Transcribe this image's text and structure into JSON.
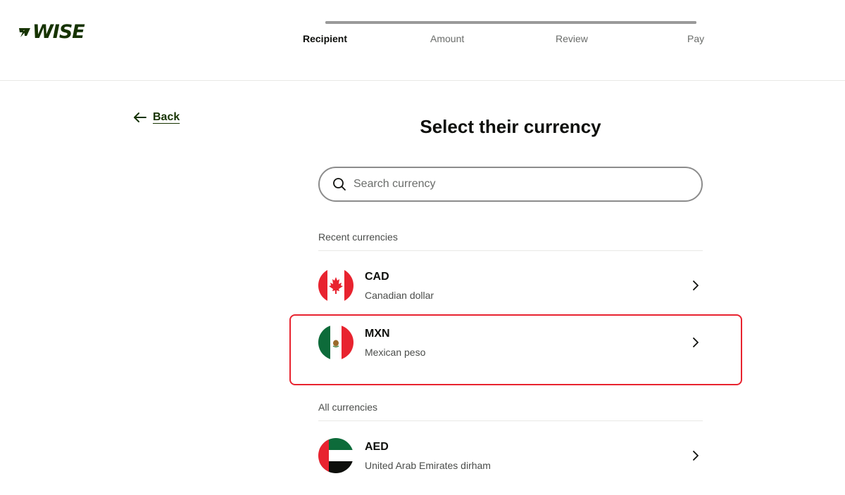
{
  "brand": {
    "name": "WISE",
    "color": "#163300",
    "logo_icon": "wise-flag-icon"
  },
  "steps": [
    {
      "label": "Recipient",
      "active": true
    },
    {
      "label": "Amount",
      "active": false
    },
    {
      "label": "Review",
      "active": false
    },
    {
      "label": "Pay",
      "active": false
    }
  ],
  "back": {
    "label": "Back",
    "icon": "arrow-left-icon"
  },
  "page": {
    "title": "Select their currency"
  },
  "search": {
    "placeholder": "Search currency",
    "value": "",
    "icon": "search-icon"
  },
  "sections": {
    "recent": {
      "label": "Recent currencies",
      "items": [
        {
          "code": "CAD",
          "name": "Canadian dollar",
          "flag": "canada-flag-icon"
        },
        {
          "code": "MXN",
          "name": "Mexican peso",
          "flag": "mexico-flag-icon"
        }
      ]
    },
    "all": {
      "label": "All currencies",
      "items": [
        {
          "code": "AED",
          "name": "United Arab Emirates dirham",
          "flag": "uae-flag-icon"
        }
      ]
    }
  },
  "colors": {
    "accent": "#163300",
    "highlight": "#e8232f",
    "text": "#0e0f0c",
    "muted": "#6a6c6a"
  }
}
